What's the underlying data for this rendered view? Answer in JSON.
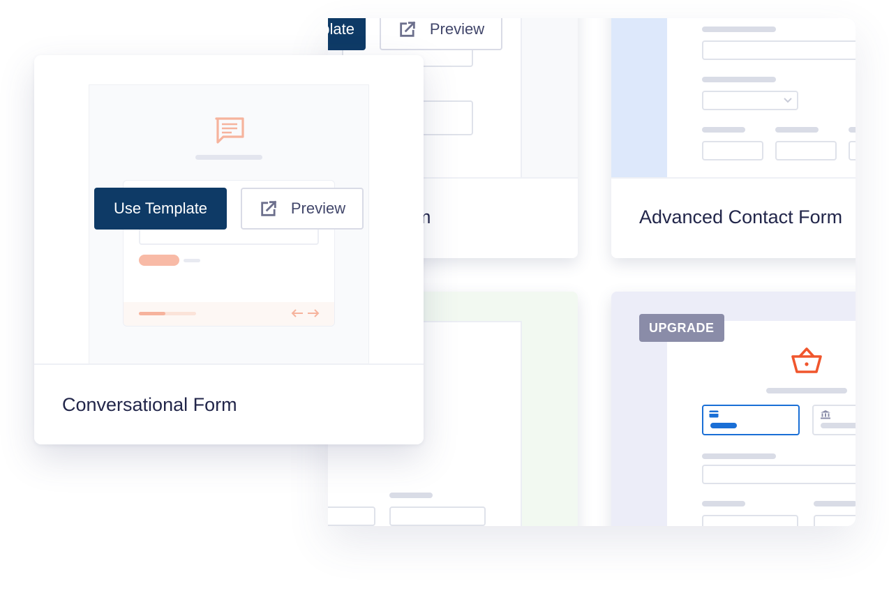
{
  "top_left_card": {
    "use_template_label": "plate",
    "preview_label": "Preview",
    "title": "rm"
  },
  "top_right_card": {
    "title": "Advanced Contact Form"
  },
  "bottom_right_card": {
    "badge": "UPGRADE",
    "icon": "basket-icon",
    "payment_icons": [
      "credit-card-icon",
      "bank-icon"
    ]
  },
  "front_card": {
    "use_template_label": "Use Template",
    "preview_label": "Preview",
    "title": "Conversational Form",
    "icons": [
      "chat-icon",
      "external-link-icon",
      "arrow-left-icon",
      "arrow-right-icon"
    ]
  },
  "colors": {
    "primary_button": "#0e3a66",
    "accent_orange": "#f0562d",
    "chat_icon_peach": "#f6b39d",
    "badge_gray": "#8a8ca8",
    "selected_blue": "#1a6fd6",
    "light_blue_panel": "#dde8fb",
    "light_purple_panel": "#ecedf8",
    "light_green_panel": "#f2f9f1"
  }
}
